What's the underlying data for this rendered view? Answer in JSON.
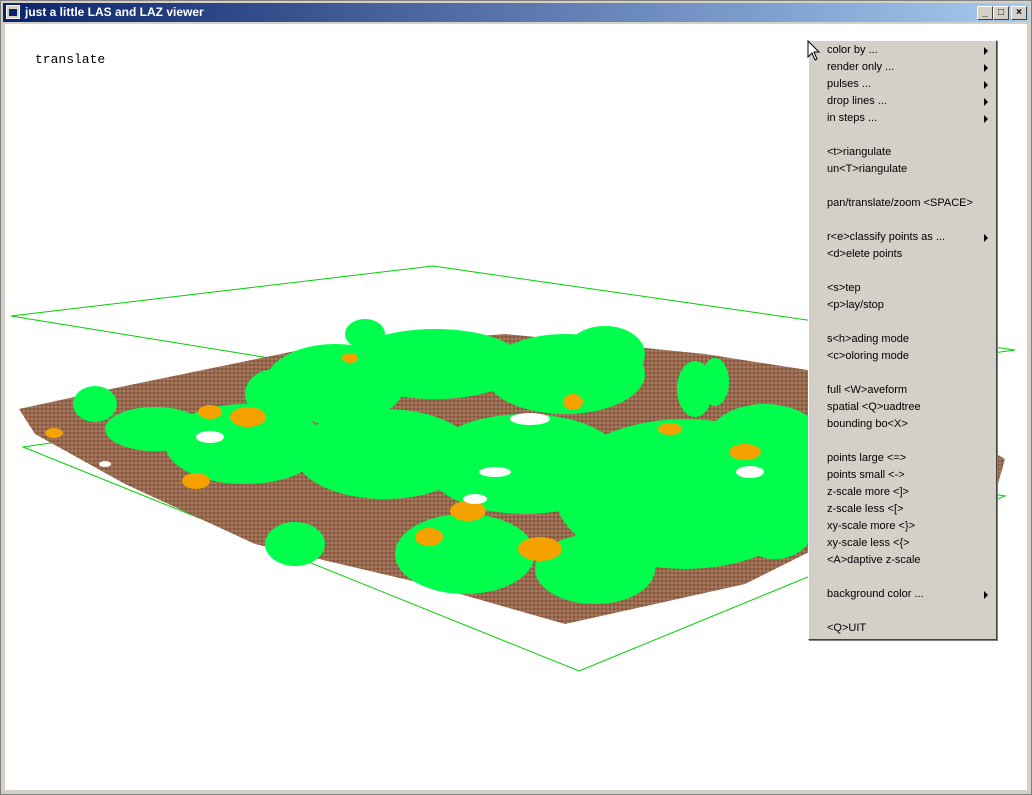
{
  "window": {
    "title": "just a little LAS and LAZ viewer"
  },
  "viewport": {
    "mode_label": "translate"
  },
  "colors": {
    "vegetation": "#00ff4c",
    "building": "#f5a100",
    "ground": "#8b5a3c",
    "bbox": "#00d000"
  },
  "context_menu": {
    "items": [
      {
        "label": "color by ...",
        "submenu": true
      },
      {
        "label": "render only ...",
        "submenu": true
      },
      {
        "label": "pulses ...",
        "submenu": true
      },
      {
        "label": "drop lines ...",
        "submenu": true
      },
      {
        "label": "in steps ...",
        "submenu": true
      },
      {
        "label": "<t>riangulate",
        "submenu": false
      },
      {
        "label": "un<T>riangulate",
        "submenu": false
      },
      {
        "label": "pan/translate/zoom <SPACE>",
        "submenu": false
      },
      {
        "label": "r<e>classify points as ...",
        "submenu": true
      },
      {
        "label": "<d>elete points",
        "submenu": false
      },
      {
        "label": "<s>tep",
        "submenu": false
      },
      {
        "label": "<p>lay/stop",
        "submenu": false
      },
      {
        "label": "s<h>ading mode",
        "submenu": false
      },
      {
        "label": "<c>oloring mode",
        "submenu": false
      },
      {
        "label": "full <W>aveform",
        "submenu": false
      },
      {
        "label": "spatial <Q>uadtree",
        "submenu": false
      },
      {
        "label": "bounding bo<X>",
        "submenu": false
      },
      {
        "label": "points large <=>",
        "submenu": false
      },
      {
        "label": "points small <->",
        "submenu": false
      },
      {
        "label": "z-scale more <]>",
        "submenu": false
      },
      {
        "label": "z-scale less <[>",
        "submenu": false
      },
      {
        "label": "xy-scale more <}>",
        "submenu": false
      },
      {
        "label": "xy-scale less <{>",
        "submenu": false
      },
      {
        "label": "<A>daptive z-scale",
        "submenu": false
      },
      {
        "label": "background color ...",
        "submenu": true
      },
      {
        "label": "<Q>UIT",
        "submenu": false
      }
    ]
  }
}
